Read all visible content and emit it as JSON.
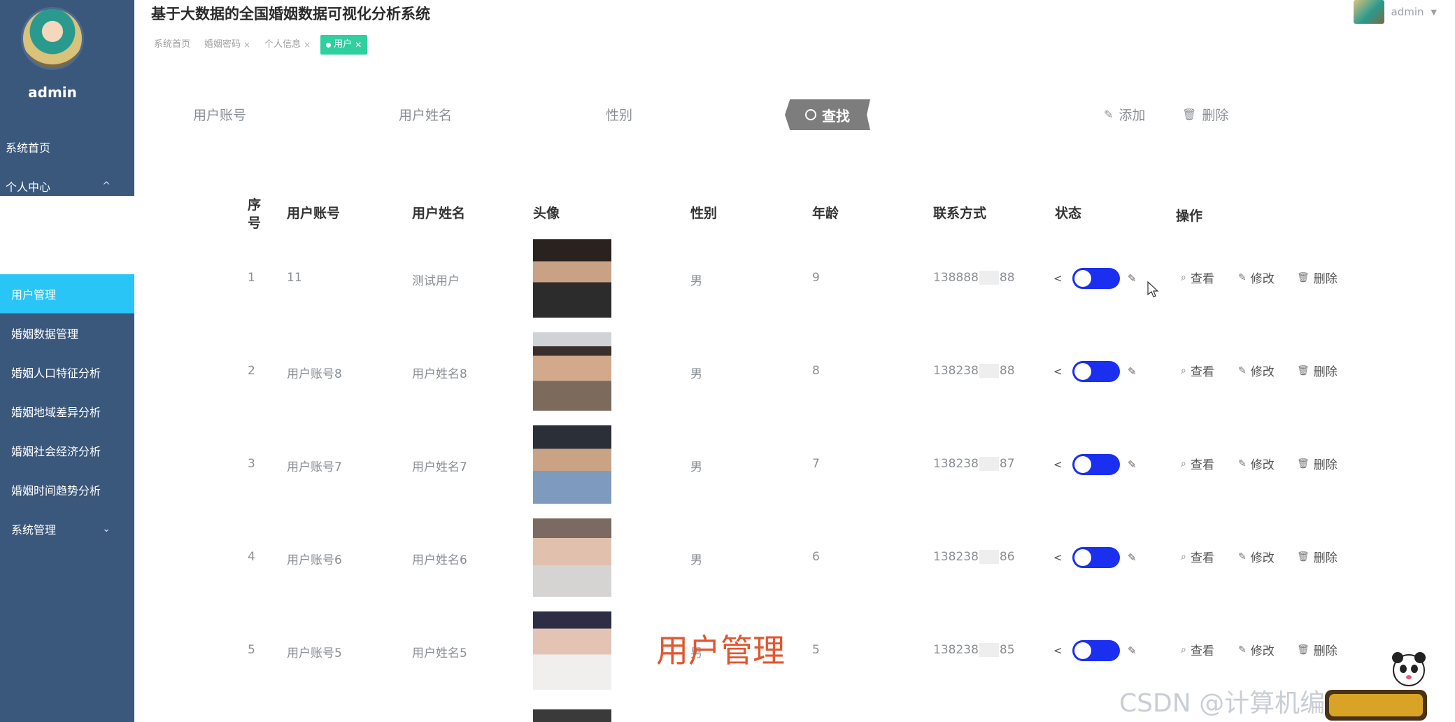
{
  "app": {
    "title": "基于大数据的全国婚姻数据可视化分析系统"
  },
  "user": {
    "name": "admin",
    "top_name": "admin"
  },
  "sidebar": {
    "top_items": [
      {
        "label": "系统首页"
      },
      {
        "label": "个人中心",
        "chevron": "^"
      }
    ],
    "bottom_items": [
      {
        "label": "用户管理",
        "active": true
      },
      {
        "label": "婚姻数据管理"
      },
      {
        "label": "婚姻人口特征分析"
      },
      {
        "label": "婚姻地域差异分析"
      },
      {
        "label": "婚姻社会经济分析"
      },
      {
        "label": "婚姻时间趋势分析"
      },
      {
        "label": "系统管理",
        "chevron": "⌄"
      }
    ]
  },
  "tabs": [
    {
      "label": "系统首页",
      "closable": false
    },
    {
      "label": "婚姻密码",
      "closable": true
    },
    {
      "label": "个人信息",
      "closable": true
    },
    {
      "label": "用户",
      "closable": true,
      "active": true
    }
  ],
  "search": {
    "account_label": "用户账号",
    "name_label": "用户姓名",
    "gender_label": "性别",
    "button_label": "查找",
    "add_label": "添加",
    "delete_label": "删除"
  },
  "table": {
    "headers": {
      "seq": "序号",
      "account": "用户账号",
      "name": "用户姓名",
      "avatar": "头像",
      "gender": "性别",
      "age": "年龄",
      "phone": "联系方式",
      "status": "状态",
      "ops": "操作"
    },
    "actions": {
      "view": "查看",
      "edit": "修改",
      "delete": "删除"
    },
    "rows": [
      {
        "seq": "1",
        "account": "11",
        "name": "测试用户",
        "gender": "男",
        "age": "9",
        "phone_head": "138888",
        "phone_tail": "88",
        "photo": "p1"
      },
      {
        "seq": "2",
        "account": "用户账号8",
        "name": "用户姓名8",
        "gender": "男",
        "age": "8",
        "phone_head": "138238",
        "phone_tail": "88",
        "photo": "p2"
      },
      {
        "seq": "3",
        "account": "用户账号7",
        "name": "用户姓名7",
        "gender": "男",
        "age": "7",
        "phone_head": "138238",
        "phone_tail": "87",
        "photo": "p3"
      },
      {
        "seq": "4",
        "account": "用户账号6",
        "name": "用户姓名6",
        "gender": "男",
        "age": "6",
        "phone_head": "138238",
        "phone_tail": "86",
        "photo": "p4"
      },
      {
        "seq": "5",
        "account": "用户账号5",
        "name": "用户姓名5",
        "gender": "男",
        "age": "5",
        "phone_head": "138238",
        "phone_tail": "85",
        "photo": "p5"
      }
    ]
  },
  "overlay": {
    "section_title": "用户管理",
    "watermark": "CSDN @计算机编程指导师"
  },
  "colors": {
    "sidebar_bg": "#3a577c",
    "active_menu": "#29c5f6",
    "active_tab": "#2ed0a0",
    "switch_on": "#1a2ff0",
    "search_btn": "#7d7d7d",
    "overlay_title": "#e2562f"
  }
}
